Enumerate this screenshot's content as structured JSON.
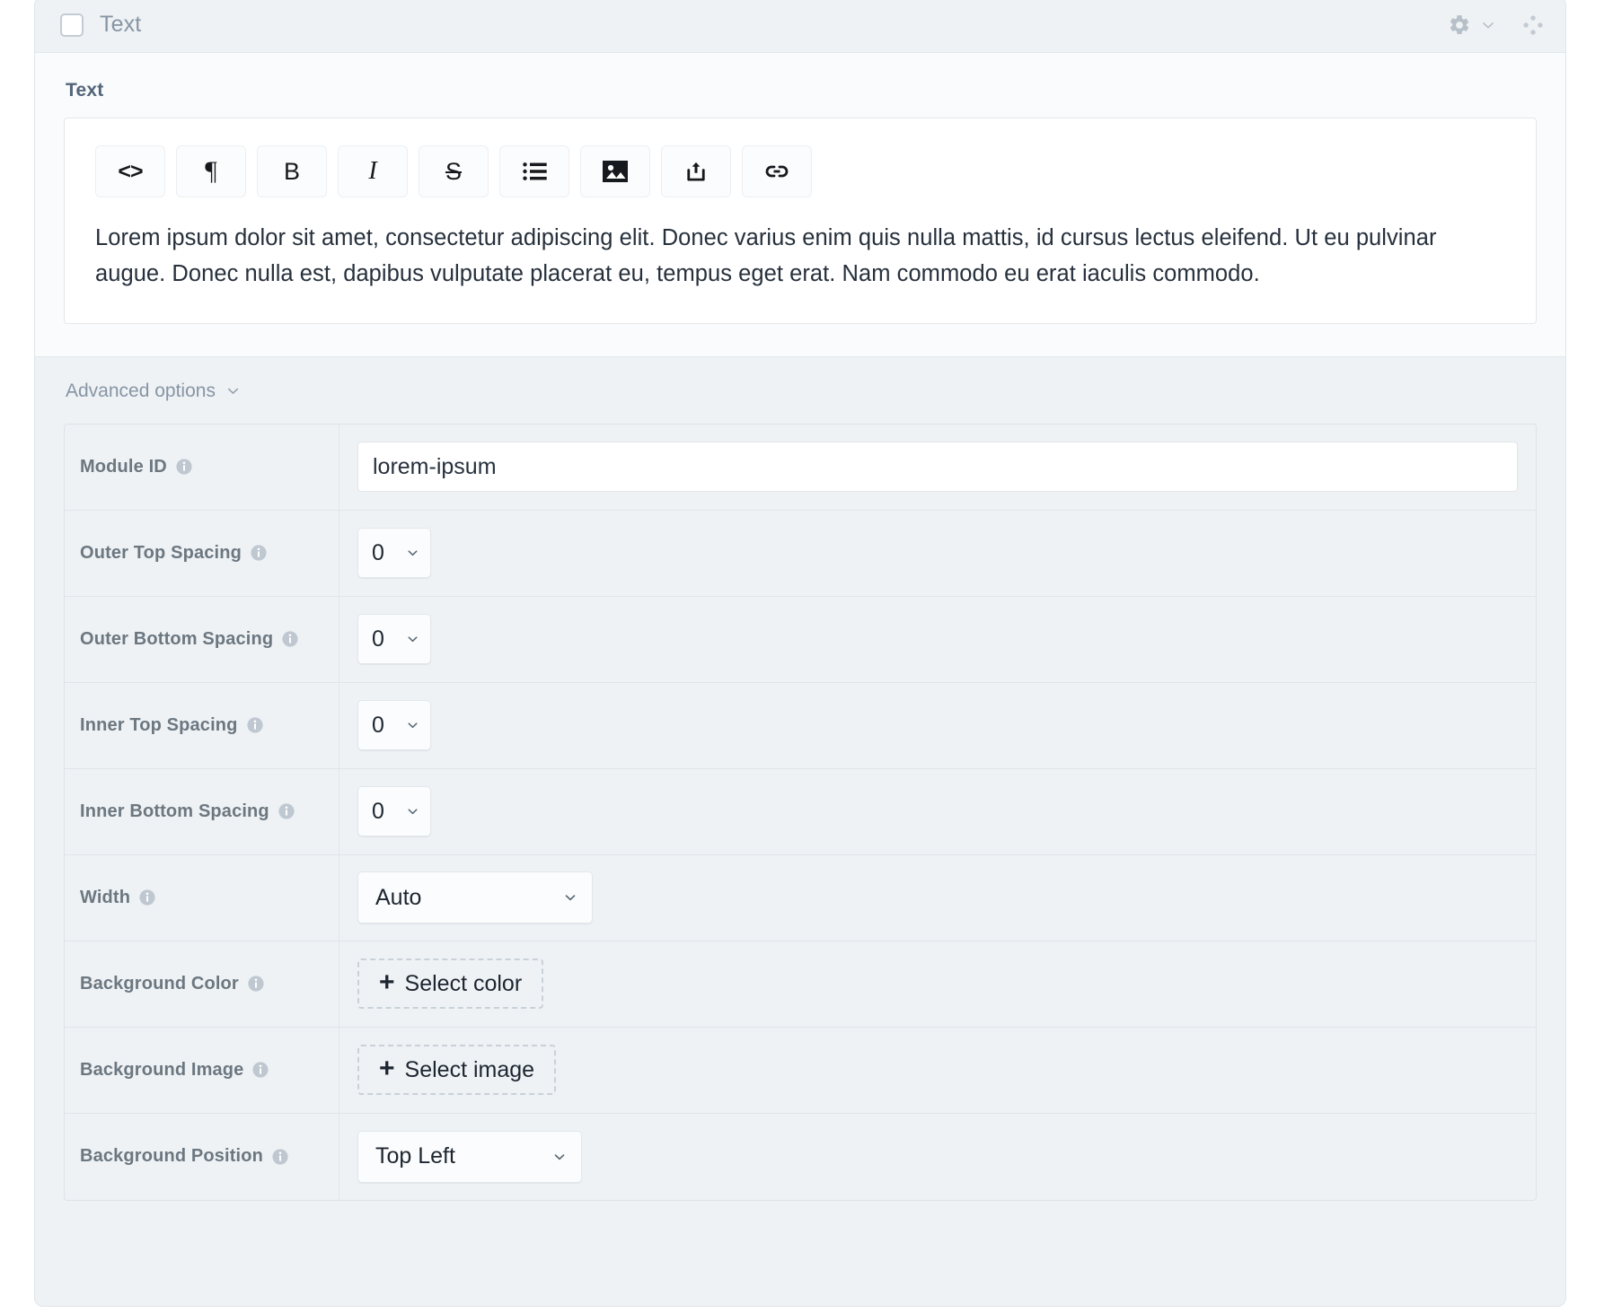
{
  "module": {
    "header": {
      "checkbox_checked": false,
      "title": "Text",
      "gear_icon": "gear-icon",
      "chevron_icon": "chevron-down-icon",
      "drag_icon": "drag-handle-icon"
    },
    "field_label": "Text",
    "editor": {
      "toolbar": [
        {
          "name": "code-button",
          "glyph": "<>",
          "kind": "code"
        },
        {
          "name": "paragraph-button",
          "glyph": "¶",
          "kind": "para"
        },
        {
          "name": "bold-button",
          "glyph": "B",
          "kind": "bold"
        },
        {
          "name": "italic-button",
          "glyph": "I",
          "kind": "ital"
        },
        {
          "name": "strikethrough-button",
          "glyph": "S",
          "kind": "strike"
        },
        {
          "name": "bullet-list-button",
          "glyph": "",
          "kind": "list"
        },
        {
          "name": "image-button",
          "glyph": "",
          "kind": "image"
        },
        {
          "name": "upload-button",
          "glyph": "",
          "kind": "upload"
        },
        {
          "name": "link-button",
          "glyph": "",
          "kind": "link"
        }
      ],
      "content": "Lorem ipsum dolor sit amet, consectetur adipiscing elit. Donec varius enim quis nulla mattis, id cursus lectus eleifend. Ut eu pulvinar augue. Donec nulla est, dapibus vulputate placerat eu, tempus eget erat. Nam commodo eu erat iaculis commodo."
    },
    "advanced": {
      "toggle_label": "Advanced options",
      "toggle_icon": "chevron-down-icon",
      "rows": {
        "module_id": {
          "label": "Module ID",
          "value": "lorem-ipsum",
          "placeholder": ""
        },
        "outer_top_spacing": {
          "label": "Outer Top Spacing",
          "value": "0"
        },
        "outer_bottom_spacing": {
          "label": "Outer Bottom Spacing",
          "value": "0"
        },
        "inner_top_spacing": {
          "label": "Inner Top Spacing",
          "value": "0"
        },
        "inner_bottom_spacing": {
          "label": "Inner Bottom Spacing",
          "value": "0"
        },
        "width": {
          "label": "Width",
          "value": "Auto"
        },
        "background_color": {
          "label": "Background Color",
          "button_label": "Select color"
        },
        "background_image": {
          "label": "Background Image",
          "button_label": "Select image"
        },
        "background_position": {
          "label": "Background Position",
          "value": "Top Left"
        }
      }
    }
  },
  "colors": {
    "panel_bg": "#eef2f5",
    "body_bg": "#f9fbfc",
    "border": "#dfe5ea",
    "label_text": "#6c7780",
    "heading_text": "#54657a",
    "muted_text": "#8795a4",
    "value_text": "#26303c",
    "dashed_border": "#c9d1d9"
  }
}
